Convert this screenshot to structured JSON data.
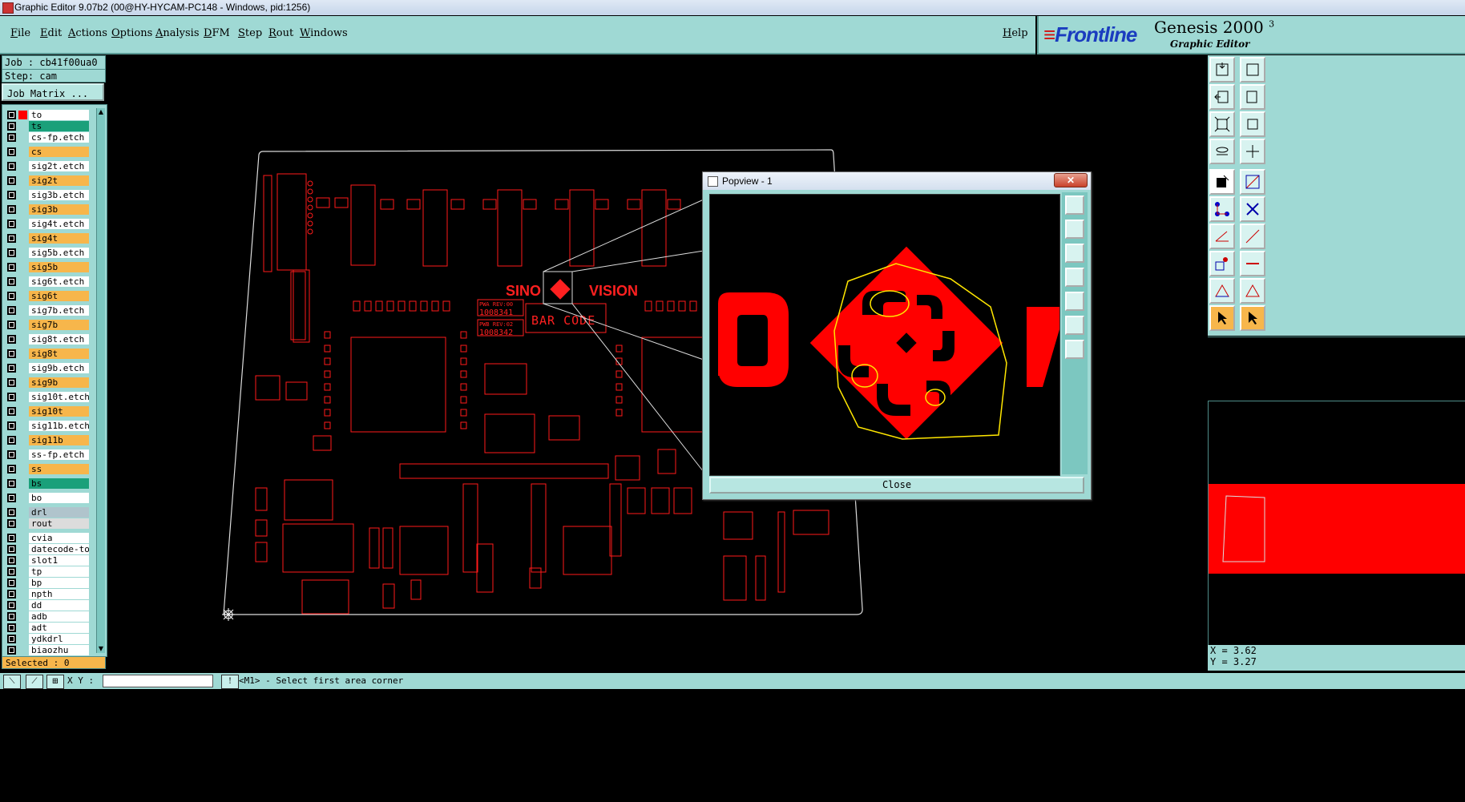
{
  "window": {
    "title": "Graphic Editor 9.07b2 (00@HY-HYCAM-PC148 - Windows, pid:1256)"
  },
  "menu": {
    "items": [
      "File",
      "Edit",
      "Actions",
      "Options",
      "Analysis",
      "DFM",
      "Step",
      "Rout",
      "Windows"
    ],
    "help": "Help"
  },
  "brand": {
    "logo_text": "Frontline",
    "product": "Genesis 2000",
    "product_sup": "3",
    "subtitle": "Graphic Editor"
  },
  "job": {
    "job_line": "Job : cb41f00ua0",
    "step_line": "Step: cam",
    "matrix_button": "Job Matrix ..."
  },
  "layers": [
    {
      "name": "to",
      "color": "#ffffff",
      "cb2": "#ff0000"
    },
    {
      "name": "ts",
      "color": "#1aa07a"
    },
    {
      "name": "cs-fp.etch",
      "color": "#ffffff"
    },
    {
      "name": "cs",
      "color": "#f7b64b"
    },
    {
      "name": "sig2t.etch",
      "color": "#ffffff"
    },
    {
      "name": "sig2t",
      "color": "#f7b64b"
    },
    {
      "name": "sig3b.etch",
      "color": "#ffffff"
    },
    {
      "name": "sig3b",
      "color": "#f7b64b"
    },
    {
      "name": "sig4t.etch",
      "color": "#ffffff"
    },
    {
      "name": "sig4t",
      "color": "#f7b64b"
    },
    {
      "name": "sig5b.etch",
      "color": "#ffffff"
    },
    {
      "name": "sig5b",
      "color": "#f7b64b"
    },
    {
      "name": "sig6t.etch",
      "color": "#ffffff"
    },
    {
      "name": "sig6t",
      "color": "#f7b64b"
    },
    {
      "name": "sig7b.etch",
      "color": "#ffffff"
    },
    {
      "name": "sig7b",
      "color": "#f7b64b"
    },
    {
      "name": "sig8t.etch",
      "color": "#ffffff"
    },
    {
      "name": "sig8t",
      "color": "#f7b64b"
    },
    {
      "name": "sig9b.etch",
      "color": "#ffffff"
    },
    {
      "name": "sig9b",
      "color": "#f7b64b"
    },
    {
      "name": "sig10t.etch",
      "color": "#ffffff"
    },
    {
      "name": "sig10t",
      "color": "#f7b64b"
    },
    {
      "name": "sig11b.etch",
      "color": "#ffffff"
    },
    {
      "name": "sig11b",
      "color": "#f7b64b"
    },
    {
      "name": "ss-fp.etch",
      "color": "#ffffff"
    },
    {
      "name": "ss",
      "color": "#f7b64b"
    },
    {
      "name": "bs",
      "color": "#1aa07a"
    },
    {
      "name": "bo",
      "color": "#ffffff"
    },
    {
      "name": "drl",
      "color": "#b0c4cc"
    },
    {
      "name": "rout",
      "color": "#dcdcdc"
    },
    {
      "name": "cvia",
      "color": "#ffffff"
    },
    {
      "name": "datecode-to",
      "color": "#ffffff"
    },
    {
      "name": "slot1",
      "color": "#ffffff"
    },
    {
      "name": "tp",
      "color": "#ffffff"
    },
    {
      "name": "bp",
      "color": "#ffffff"
    },
    {
      "name": "npth",
      "color": "#ffffff"
    },
    {
      "name": "dd",
      "color": "#ffffff"
    },
    {
      "name": "adb",
      "color": "#ffffff"
    },
    {
      "name": "adt",
      "color": "#ffffff"
    },
    {
      "name": "ydkdrl",
      "color": "#ffffff"
    },
    {
      "name": "biaozhu",
      "color": "#ffffff"
    }
  ],
  "status": {
    "selected": "Selected : 0",
    "xy_label": "X Y :",
    "prompt": "<M1> - Select first area corner",
    "x": "X = 3.62",
    "y": "Y = 3.27"
  },
  "board": {
    "logo_left": "SINO",
    "logo_right": "VISION",
    "barcode": "BAR CODE",
    "pwa": "PWA REV:00",
    "pwa_num": "1008341",
    "pwb": "PWB REV:02",
    "pwb_num": "1008342"
  },
  "popview": {
    "title": "Popview - 1",
    "close_x": "✕",
    "close_button": "Close"
  },
  "colors": {
    "panel": "#9fd9d4",
    "copper": "#ff0000",
    "orange": "#f7b64b"
  }
}
